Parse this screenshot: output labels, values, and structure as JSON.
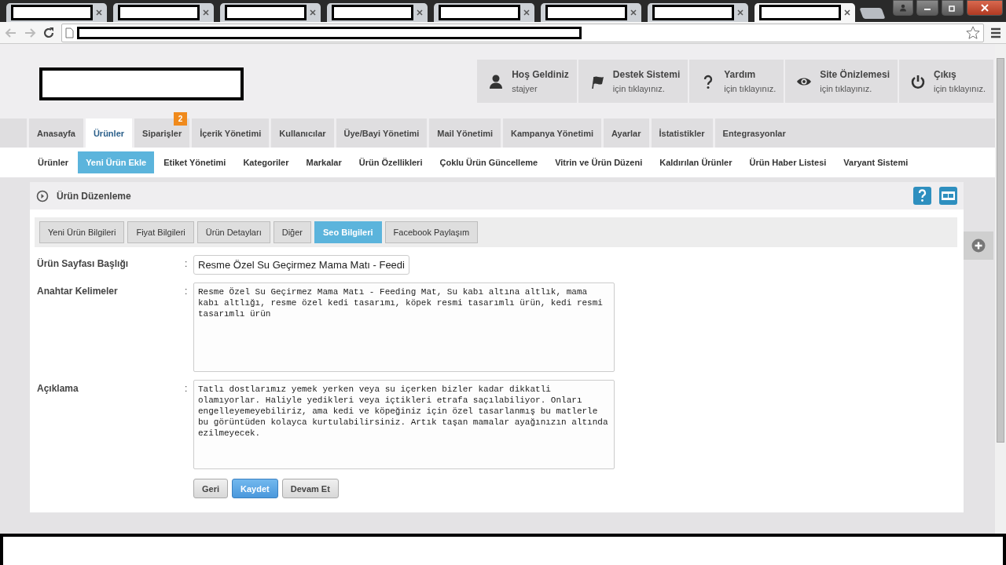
{
  "browser": {
    "tabs": [
      {
        "selected": false
      },
      {
        "selected": false
      },
      {
        "selected": false
      },
      {
        "selected": false
      },
      {
        "selected": false
      },
      {
        "selected": false
      },
      {
        "selected": false
      },
      {
        "selected": true
      }
    ]
  },
  "header_links": [
    {
      "kind": "user",
      "title": "Hoş Geldiniz",
      "subtitle": "stajyer"
    },
    {
      "kind": "flag",
      "title": "Destek Sistemi",
      "subtitle": "için tıklayınız."
    },
    {
      "kind": "help",
      "title": "Yardım",
      "subtitle": "için tıklayınız."
    },
    {
      "kind": "eye",
      "title": "Site Önizlemesi",
      "subtitle": "için tıklayınız."
    },
    {
      "kind": "power",
      "title": "Çıkış",
      "subtitle": "için tıklayınız."
    }
  ],
  "main_nav": [
    {
      "label": "Anasayfa",
      "selected": false
    },
    {
      "label": "Ürünler",
      "selected": true
    },
    {
      "label": "Siparişler",
      "selected": false,
      "badge": "2"
    },
    {
      "label": "İçerik Yönetimi",
      "selected": false
    },
    {
      "label": "Kullanıcılar",
      "selected": false
    },
    {
      "label": "Üye/Bayi Yönetimi",
      "selected": false
    },
    {
      "label": "Mail Yönetimi",
      "selected": false
    },
    {
      "label": "Kampanya Yönetimi",
      "selected": false
    },
    {
      "label": "Ayarlar",
      "selected": false
    },
    {
      "label": "İstatistikler",
      "selected": false
    },
    {
      "label": "Entegrasyonlar",
      "selected": false
    }
  ],
  "sub_nav": [
    {
      "label": "Ürünler",
      "selected": false
    },
    {
      "label": "Yeni Ürün Ekle",
      "selected": true
    },
    {
      "label": "Etiket Yönetimi",
      "selected": false
    },
    {
      "label": "Kategoriler",
      "selected": false
    },
    {
      "label": "Markalar",
      "selected": false
    },
    {
      "label": "Ürün Özellikleri",
      "selected": false
    },
    {
      "label": "Çoklu Ürün Güncelleme",
      "selected": false
    },
    {
      "label": "Vitrin ve Ürün Düzeni",
      "selected": false
    },
    {
      "label": "Kaldırılan Ürünler",
      "selected": false
    },
    {
      "label": "Ürün Haber Listesi",
      "selected": false
    },
    {
      "label": "Varyant Sistemi",
      "selected": false
    }
  ],
  "panel": {
    "title": "Ürün Düzenleme",
    "tabs": [
      {
        "label": "Yeni Ürün Bilgileri",
        "selected": false
      },
      {
        "label": "Fiyat Bilgileri",
        "selected": false
      },
      {
        "label": "Ürün Detayları",
        "selected": false
      },
      {
        "label": "Diğer",
        "selected": false
      },
      {
        "label": "Seo Bilgileri",
        "selected": true
      },
      {
        "label": "Facebook Paylaşım",
        "selected": false
      }
    ],
    "fields": [
      {
        "kind": "input",
        "label": "Ürün Sayfası Başlığı",
        "separator": ":",
        "value": "Resme Özel Su Geçirmez Mama Matı - Feedi"
      },
      {
        "kind": "textarea",
        "label": "Anahtar Kelimeler",
        "separator": ":",
        "value": "Resme Özel Su Geçirmez Mama Matı - Feeding Mat, Su kabı altına altlık, mama kabı altlığı, resme özel kedi tasarımı, köpek resmi tasarımlı ürün, kedi resmi tasarımlı ürün"
      },
      {
        "kind": "textarea",
        "label": "Açıklama",
        "separator": ":",
        "value": "Tatlı dostlarımız yemek yerken veya su içerken bizler kadar dikkatli olamıyorlar. Haliyle yedikleri veya içtikleri etrafa saçılabiliyor. Onları engelleyemeyebiliriz, ama kedi ve köpeğiniz için özel tasarlanmış bu matlerle bu görüntüden kolayca kurtulabilirsiniz. Artık taşan mamalar ayağınızın altında ezilmeyecek."
      }
    ],
    "buttons": [
      {
        "label": "Geri",
        "primary": false
      },
      {
        "label": "Kaydet",
        "primary": true
      },
      {
        "label": "Devam Et",
        "primary": false
      }
    ]
  }
}
